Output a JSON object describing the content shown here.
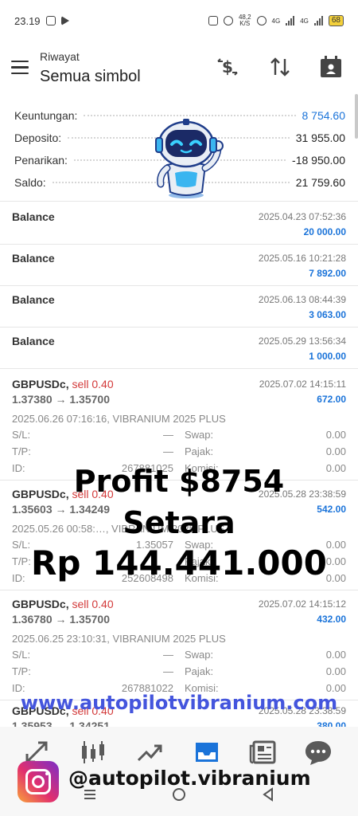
{
  "status_bar": {
    "time": "23.19",
    "net_speed": "48,2",
    "net_unit": "K/S",
    "network_1": "4G",
    "network_2": "4G",
    "battery": "68"
  },
  "header": {
    "subtitle": "Riwayat",
    "title": "Semua simbol",
    "icons": [
      "menu-icon",
      "currency-exchange-icon",
      "sort-icon",
      "calendar-icon"
    ]
  },
  "summary": [
    {
      "label": "Keuntungan:",
      "value": "8 754.60",
      "color": "#1a73d9"
    },
    {
      "label": "Deposito:",
      "value": "31 955.00",
      "color": "#222222"
    },
    {
      "label": "Penarikan:",
      "value": "-18 950.00",
      "color": "#222222"
    },
    {
      "label": "Saldo:",
      "value": "21 759.60",
      "color": "#222222"
    }
  ],
  "balances": [
    {
      "name": "Balance",
      "time": "2025.04.23 07:52:36",
      "amount": "20 000.00"
    },
    {
      "name": "Balance",
      "time": "2025.05.16 10:21:28",
      "amount": "7 892.00"
    },
    {
      "name": "Balance",
      "time": "2025.06.13 08:44:39",
      "amount": "3 063.00"
    },
    {
      "name": "Balance",
      "time": "2025.05.29 13:56:34",
      "amount": "1 000.00"
    }
  ],
  "trades": [
    {
      "symbol": "GBPUSDc",
      "sep": ",",
      "side": "sell 0.40",
      "prices": "1.37380 → 1.35700",
      "close_time": "2025.07.02 14:15:11",
      "profit": "672.00",
      "open_info": "2025.06.26 07:16:16, VIBRANIUM 2025 PLUS",
      "sl_label": "S/L:",
      "sl": "—",
      "tp_label": "T/P:",
      "tp": "—",
      "id_label": "ID:",
      "id": "267881025",
      "swap_label": "Swap:",
      "swap": "0.00",
      "tax_label": "Pajak:",
      "tax": "0.00",
      "comm_label": "Komisi:",
      "comm": "0.00"
    },
    {
      "symbol": "GBPUSDc",
      "sep": ",",
      "side": "sell 0.40",
      "prices": "1.35603 → 1.34249",
      "close_time": "2025.05.28 23:38:59",
      "profit": "542.00",
      "open_info": "2025.05.26 00:58:…, VIBRANIUM 2025 PLUS",
      "sl_label": "S/L:",
      "sl": "1.35057",
      "tp_label": "T/P:",
      "tp": "",
      "id_label": "ID:",
      "id": "252608498",
      "swap_label": "Swap:",
      "swap": "0.00",
      "tax_label": "Pajak:",
      "tax": "0.00",
      "comm_label": "Komisi:",
      "comm": "0.00"
    },
    {
      "symbol": "GBPUSDc",
      "sep": ",",
      "side": "sell 0.40",
      "prices": "1.36780 → 1.35700",
      "close_time": "2025.07.02 14:15:12",
      "profit": "432.00",
      "open_info": "2025.06.25 23:10:31, VIBRANIUM 2025 PLUS",
      "sl_label": "S/L:",
      "sl": "—",
      "tp_label": "T/P:",
      "tp": "—",
      "id_label": "ID:",
      "id": "267881022",
      "swap_label": "Swap:",
      "swap": "0.00",
      "tax_label": "Pajak:",
      "tax": "0.00",
      "comm_label": "Komisi:",
      "comm": "0.00"
    },
    {
      "symbol": "GBPUSDc",
      "sep": ",",
      "side": "sell 0.40",
      "prices": "1.35953 → 1.34251",
      "close_time": "2025.05.28 23:38:59",
      "profit": "380.00"
    }
  ],
  "overlay": {
    "line1": "Profit $8754",
    "line2": "Setara",
    "line3": "Rp 144.441.000",
    "url": "www.autopilotvibranium.com",
    "handle": "@autopilot.vibranium"
  },
  "bottom_nav": [
    "trade-icon",
    "chart-icon",
    "trend-icon",
    "history-icon",
    "news-icon",
    "chat-icon"
  ],
  "accent": "#1a73d9",
  "sell_color": "#d33a3a"
}
